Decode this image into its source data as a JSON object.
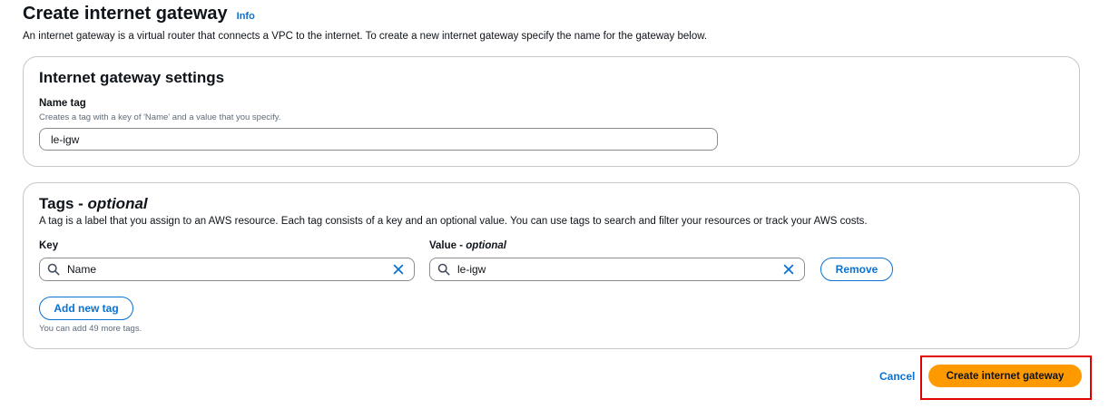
{
  "header": {
    "title": "Create internet gateway",
    "info_label": "Info",
    "description": "An internet gateway is a virtual router that connects a VPC to the internet. To create a new internet gateway specify the name for the gateway below."
  },
  "settings_panel": {
    "heading": "Internet gateway settings",
    "name_tag_label": "Name tag",
    "name_tag_hint": "Creates a tag with a key of 'Name' and a value that you specify.",
    "name_tag_value": "le-igw"
  },
  "tags_panel": {
    "heading_main": "Tags - ",
    "heading_optional": "optional",
    "description": "A tag is a label that you assign to an AWS resource. Each tag consists of a key and an optional value. You can use tags to search and filter your resources or track your AWS costs.",
    "key_label": "Key",
    "value_label_main": "Value - ",
    "value_label_optional": "optional",
    "tag_rows": [
      {
        "key": "Name",
        "value": "le-igw",
        "remove_label": "Remove"
      }
    ],
    "add_tag_label": "Add new tag",
    "limit_hint": "You can add 49 more tags."
  },
  "footer": {
    "cancel_label": "Cancel",
    "create_label": "Create internet gateway"
  },
  "colors": {
    "accent": "#0972d3",
    "primary_button": "#ff9900",
    "highlight": "#e00000"
  }
}
